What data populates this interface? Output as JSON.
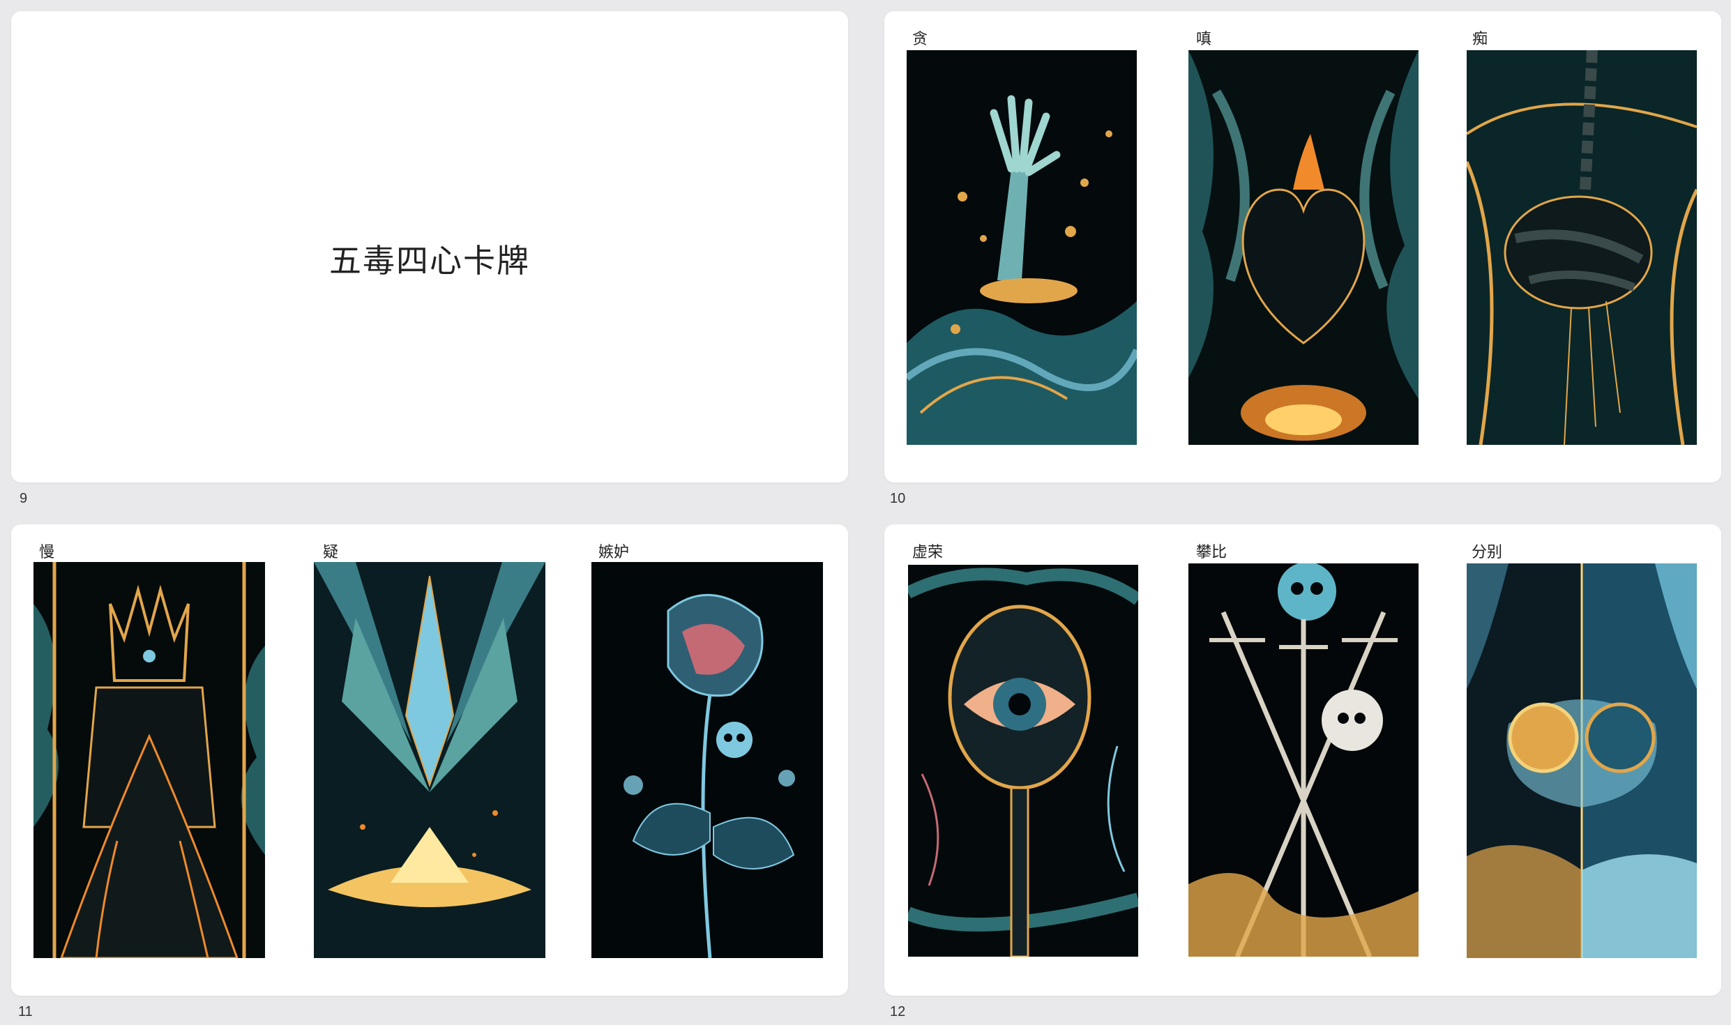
{
  "slides": [
    {
      "number": "9",
      "title": "五毒四心卡牌"
    },
    {
      "number": "10",
      "cards": [
        {
          "label": "贪",
          "icon": "skeleton-hand-coins-icon"
        },
        {
          "label": "嗔",
          "icon": "burning-heart-icon"
        },
        {
          "label": "痴",
          "icon": "chained-brain-icon"
        }
      ]
    },
    {
      "number": "11",
      "cards": [
        {
          "label": "慢",
          "icon": "throne-king-icon"
        },
        {
          "label": "疑",
          "icon": "crystal-plant-icon"
        },
        {
          "label": "嫉妒",
          "icon": "rose-skull-icon"
        }
      ]
    },
    {
      "number": "12",
      "cards": [
        {
          "label": "虚荣",
          "icon": "mirror-eye-icon"
        },
        {
          "label": "攀比",
          "icon": "skulls-swords-icon"
        },
        {
          "label": "分别",
          "icon": "split-lemon-icon"
        }
      ]
    }
  ],
  "colors": {
    "background": "#e9e9ec",
    "slide": "#ffffff",
    "card_dark": "#05080a",
    "teal": "#2e6f73",
    "gold": "#e2a64a",
    "orange": "#f08a2a",
    "ice": "#7fc9e0"
  }
}
